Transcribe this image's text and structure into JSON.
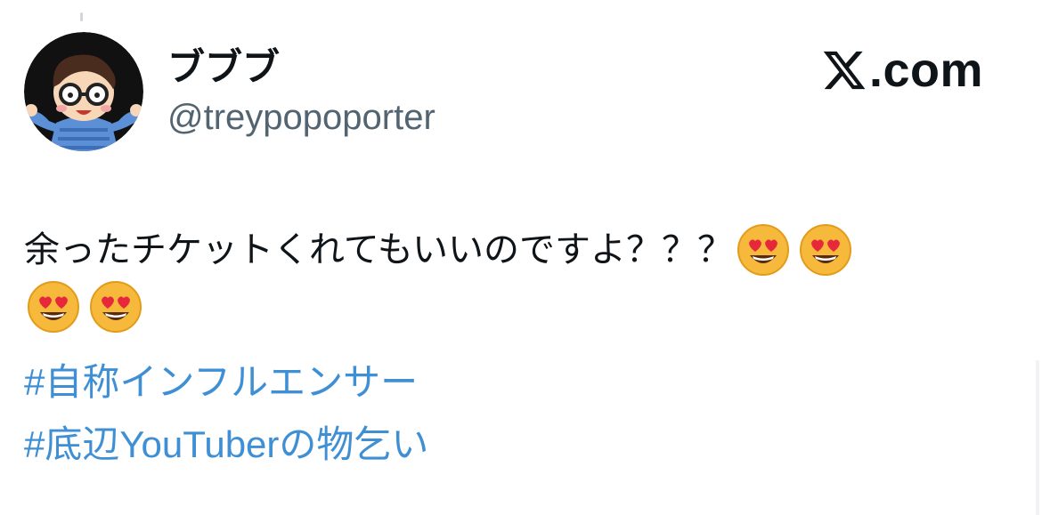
{
  "author": {
    "display_name": "ブブブ",
    "handle": "@treypopoporter"
  },
  "brand": {
    "logo_icon": "x-logo-icon",
    "text": ".com"
  },
  "tweet": {
    "text": "余ったチケットくれてもいいのですよ？？？",
    "emojis": [
      "heart-eyes-emoji",
      "heart-eyes-emoji",
      "heart-eyes-emoji",
      "heart-eyes-emoji"
    ],
    "hashtags": [
      "#自称インフルエンサー",
      "#底辺YouTuberの物乞い"
    ]
  },
  "colors": {
    "text": "#0f1419",
    "secondary_text": "#536471",
    "hashtag": "#3f8fd4",
    "background": "#ffffff"
  }
}
